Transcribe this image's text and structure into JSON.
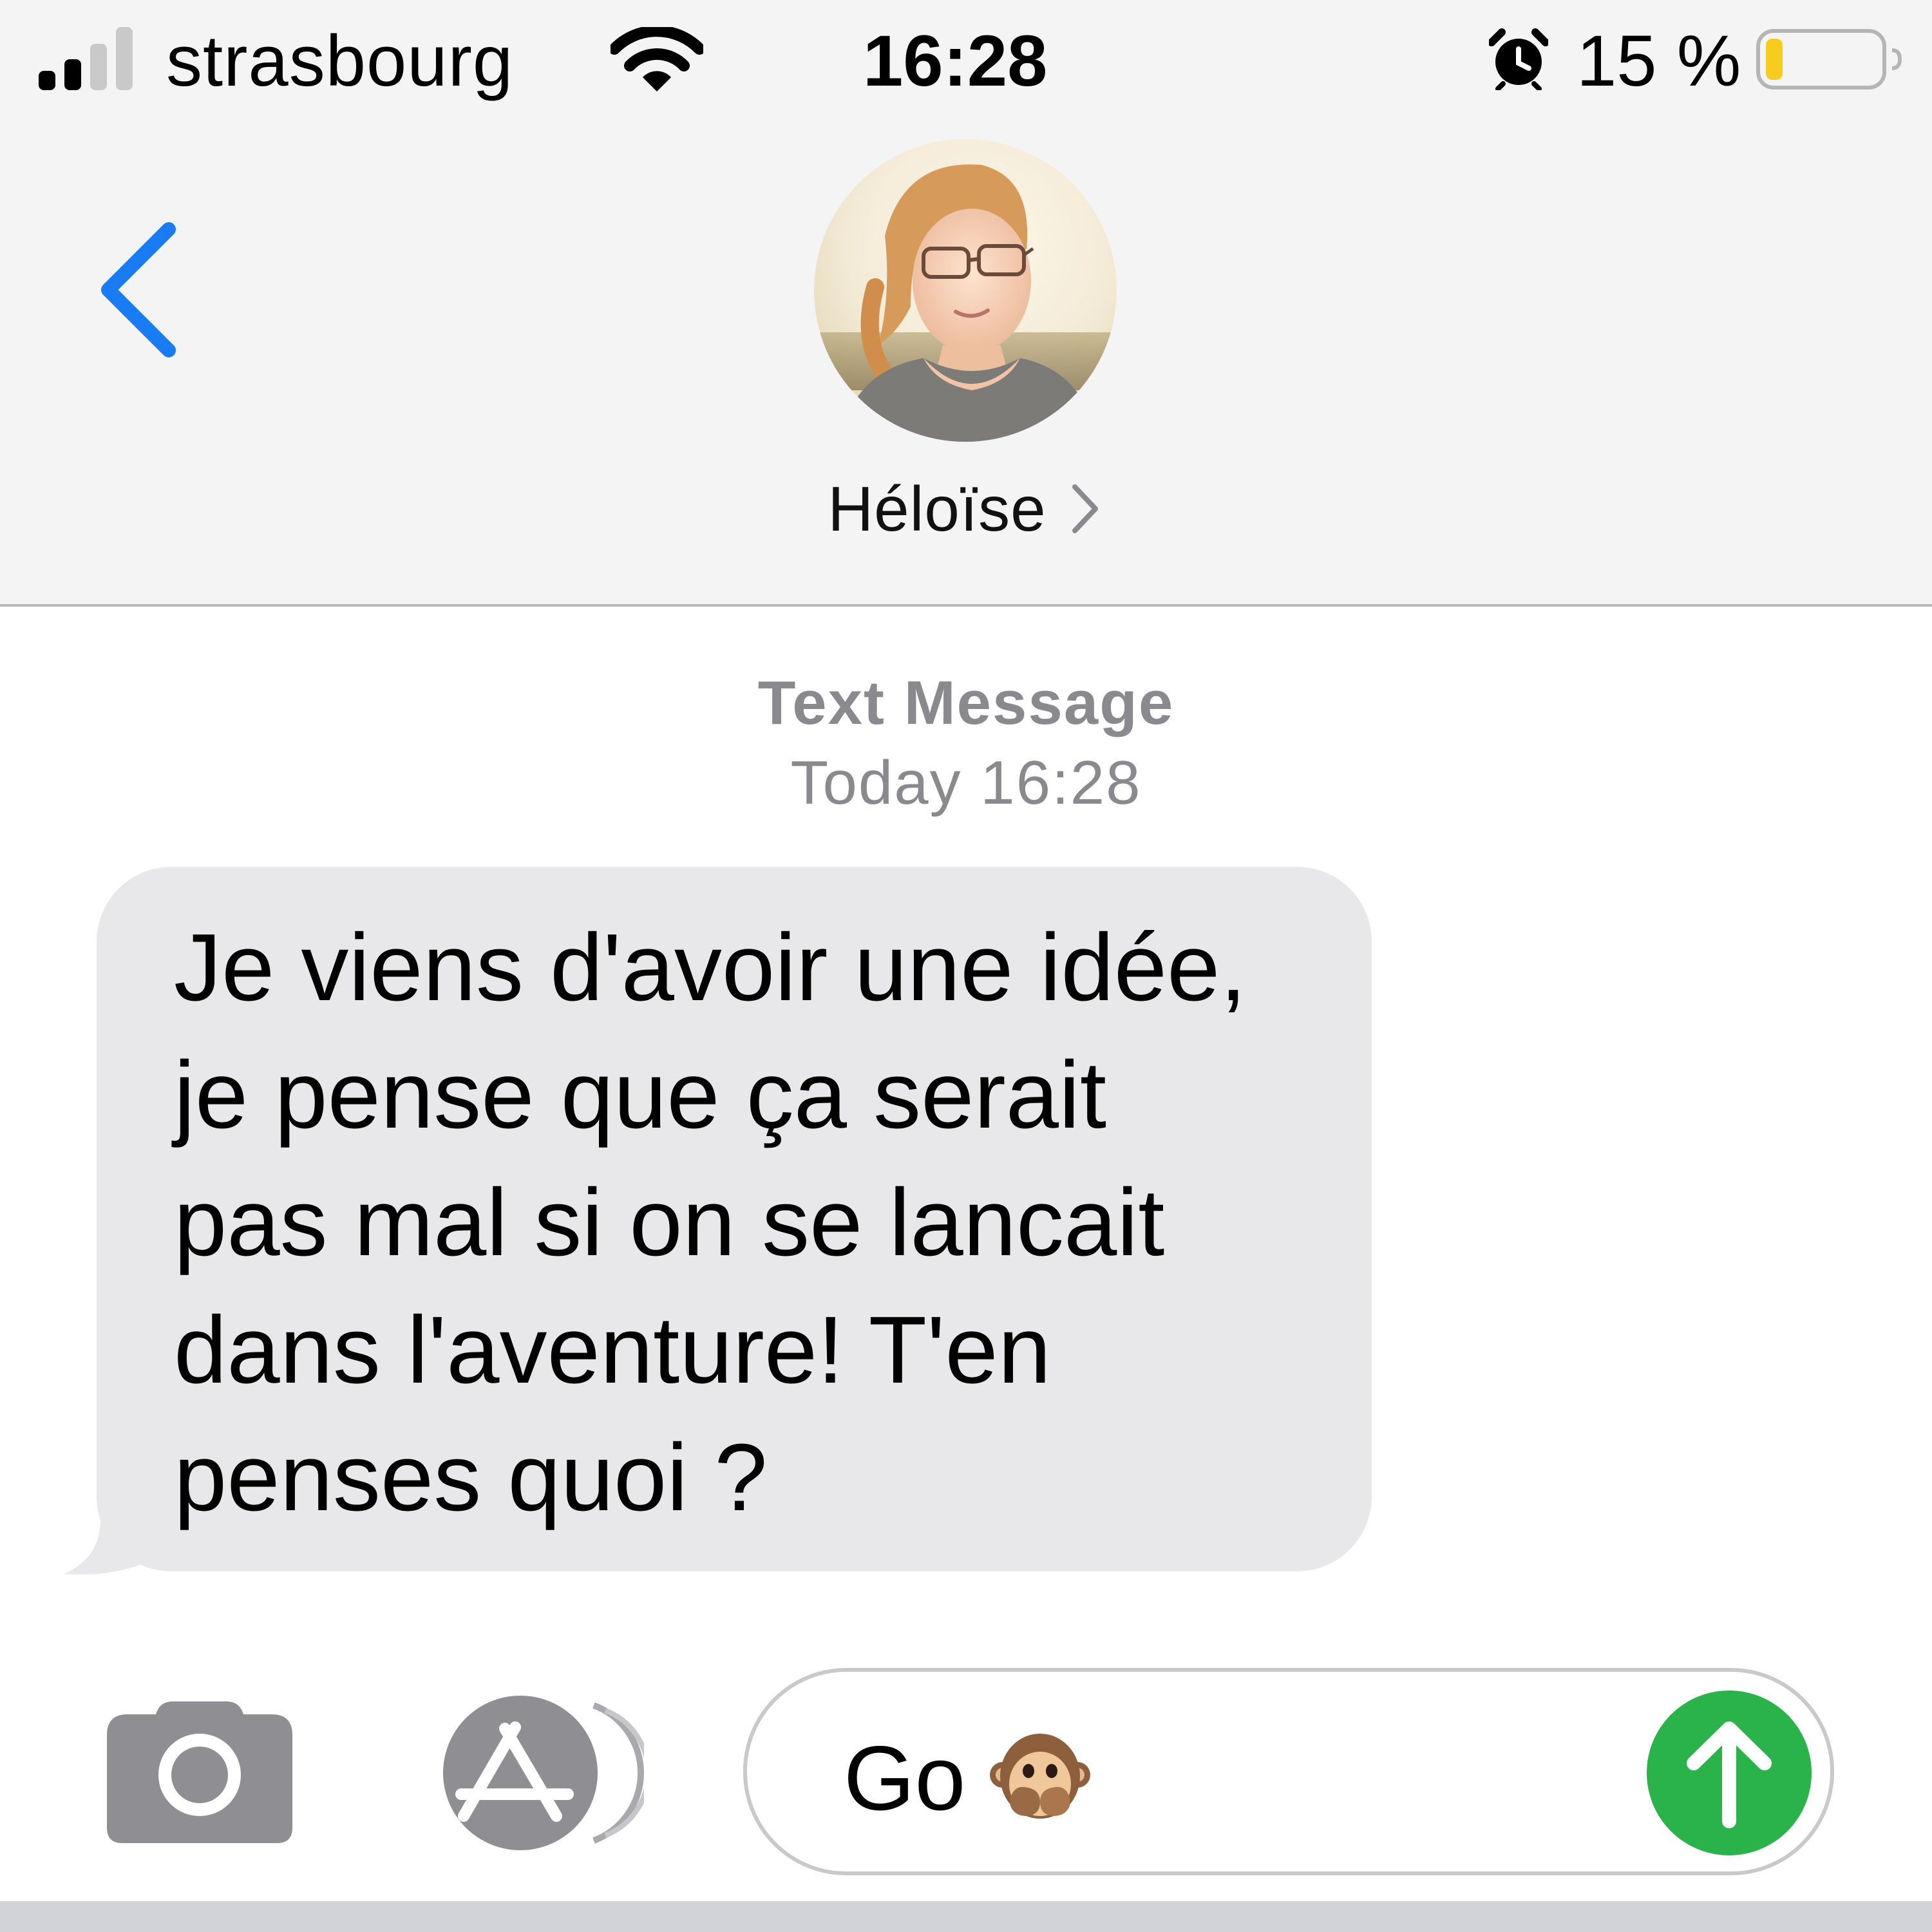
{
  "status_bar": {
    "carrier": "strasbourg",
    "time": "16:28",
    "battery_percent": "15 %",
    "battery_level": 0.15,
    "signal_bars_active": 2,
    "signal_bars_total": 4,
    "icons": [
      "signal-icon",
      "wifi-icon",
      "alarm-icon",
      "battery-icon"
    ]
  },
  "header": {
    "back_icon": "chevron-left-icon",
    "contact_name": "Héloïse",
    "contact_chevron_icon": "chevron-right-icon"
  },
  "conversation": {
    "message_type": "Text Message",
    "timestamp": "Today 16:28",
    "messages": [
      {
        "direction": "incoming",
        "text": "Je viens d'avoir une idée,\nje pense que ça serait\npas mal si on se lancait\ndans l'aventure! T'en\npenses quoi ?"
      }
    ]
  },
  "input_bar": {
    "camera_icon": "camera-icon",
    "appstore_icon": "app-store-icon",
    "draft_text": "Go",
    "draft_emoji": "speak-no-evil-monkey-icon",
    "send_icon": "arrow-up-icon"
  },
  "colors": {
    "accent_blue": "#1a7cf5",
    "send_green": "#2ab24b",
    "incoming_bubble": "#e8e8ea",
    "meta_gray": "#8a8a8e",
    "battery_yellow": "#f6cd1f"
  }
}
